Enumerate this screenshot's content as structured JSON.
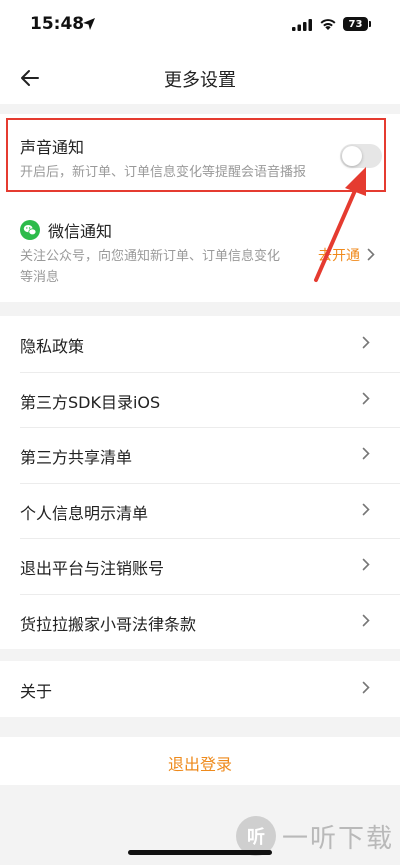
{
  "status_bar": {
    "time": "15:48",
    "battery": "73"
  },
  "nav": {
    "title": "更多设置"
  },
  "sound_notification": {
    "title": "声音通知",
    "description": "开启后，新订单、订单信息变化等提醒会语音播报",
    "toggle_on": false
  },
  "wechat_notification": {
    "title": "微信通知",
    "description_line1": "关注公众号，向您通知新订单、订单信息变化",
    "description_line2": "等消息",
    "action": "去开通"
  },
  "menu_items": [
    {
      "label": "隐私政策"
    },
    {
      "label": "第三方SDK目录iOS"
    },
    {
      "label": "第三方共享清单"
    },
    {
      "label": "个人信息明示清单"
    },
    {
      "label": "退出平台与注销账号"
    },
    {
      "label": "货拉拉搬家小哥法律条款"
    }
  ],
  "about": {
    "label": "关于"
  },
  "logout": {
    "label": "退出登录"
  },
  "watermark": {
    "logo_text": "听",
    "text": "一听下载"
  },
  "colors": {
    "accent": "#ee8a1c",
    "highlight": "#e53b30",
    "wechat": "#2dbb4a"
  }
}
